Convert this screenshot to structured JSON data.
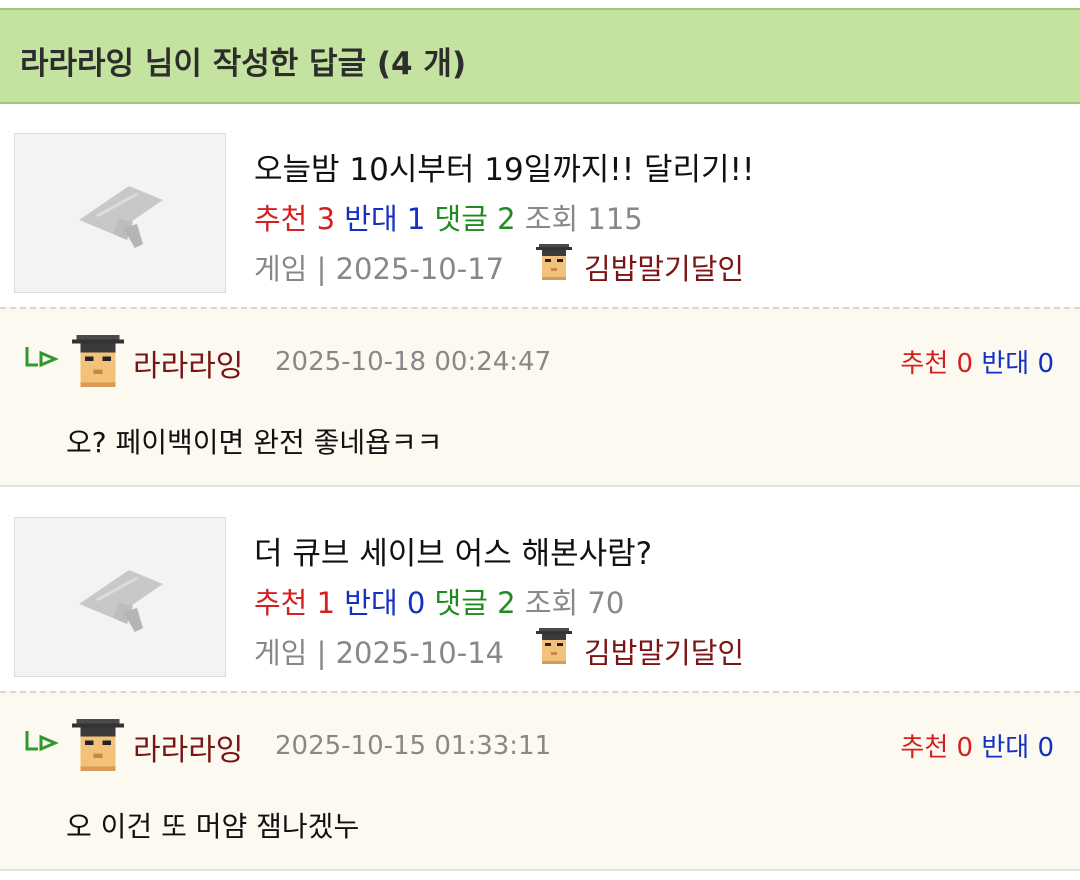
{
  "header": {
    "title": "라라라잉 님이 작성한 답글 (4 개)"
  },
  "posts": [
    {
      "title": "오늘밤 10시부터 19일까지!! 달리기!!",
      "recommend_label": "추천",
      "recommend": "3",
      "oppose_label": "반대",
      "oppose": "1",
      "comment_label": "댓글",
      "comments": "2",
      "views_label": "조회",
      "views": "115",
      "category": "게임",
      "separator": "|",
      "date": "2025-10-17",
      "author": "김밥말기달인",
      "reply": {
        "author": "라라라잉",
        "datetime": "2025-10-18 00:24:47",
        "recommend_label": "추천",
        "recommend": "0",
        "oppose_label": "반대",
        "oppose": "0",
        "text": "오? 페이백이면 완전 좋네욥ㅋㅋ"
      }
    },
    {
      "title": "더 큐브 세이브 어스 해본사람?",
      "recommend_label": "추천",
      "recommend": "1",
      "oppose_label": "반대",
      "oppose": "0",
      "comment_label": "댓글",
      "comments": "2",
      "views_label": "조회",
      "views": "70",
      "category": "게임",
      "separator": "|",
      "date": "2025-10-14",
      "author": "김밥말기달인",
      "reply": {
        "author": "라라라잉",
        "datetime": "2025-10-15 01:33:11",
        "recommend_label": "추천",
        "recommend": "0",
        "oppose_label": "반대",
        "oppose": "0",
        "text": "오 이건 또 머얌 잼나겠누"
      }
    }
  ],
  "icons": {
    "thumbnail": "graduation-cap-placeholder-icon",
    "avatar": "pixel-avatar-icon",
    "reply": "reply-arrow-icon"
  }
}
